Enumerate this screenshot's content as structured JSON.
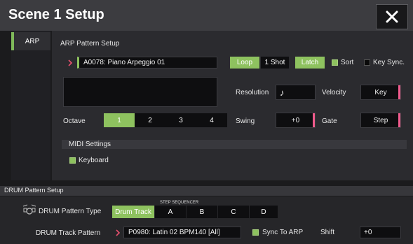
{
  "header": {
    "title": "Scene 1 Setup"
  },
  "tabs": {
    "arp_label": "ARP"
  },
  "arp": {
    "section_title": "ARP Pattern Setup",
    "pattern_value": "A0078: Piano Arpeggio 01",
    "loop_label": "Loop",
    "one_shot_label": "1 Shot",
    "latch_label": "Latch",
    "sort_label": "Sort",
    "key_sync_label": "Key Sync.",
    "resolution_label": "Resolution",
    "resolution_value": "♪",
    "velocity_label": "Velocity",
    "velocity_value": "Key",
    "octave_label": "Octave",
    "octave_options": [
      "1",
      "2",
      "3",
      "4"
    ],
    "swing_label": "Swing",
    "swing_value": "+0",
    "gate_label": "Gate",
    "gate_value": "Step",
    "midi_settings_label": "MIDI Settings",
    "keyboard_label": "Keyboard"
  },
  "drum": {
    "section_title": "DRUM Pattern Setup",
    "pattern_type_label": "DRUM Pattern Type",
    "step_sequencer_label": "STEP SEQUENCER",
    "types": [
      "Drum Track",
      "A",
      "B",
      "C",
      "D"
    ],
    "track_pattern_label": "DRUM Track Pattern",
    "track_pattern_value": "P0980: Latin 02 BPM140 [All]",
    "sync_to_arp_label": "Sync To ARP",
    "shift_label": "Shift",
    "shift_value": "+0"
  },
  "colors": {
    "accent_green": "#8ec25f",
    "indicator_pink": "#ef5a8c",
    "selector_arrow": "#e8506e"
  }
}
